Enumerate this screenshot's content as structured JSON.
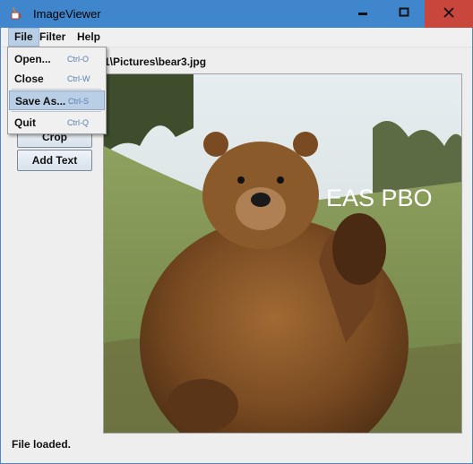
{
  "window": {
    "title": "ImageViewer",
    "controls": [
      "minimize-icon",
      "maximize-icon",
      "close-icon"
    ]
  },
  "menubar": {
    "items": [
      {
        "label": "File"
      },
      {
        "label": "Filter"
      },
      {
        "label": "Help"
      }
    ]
  },
  "file_menu": {
    "items": [
      {
        "label": "Open...",
        "shortcut": "Ctrl-O"
      },
      {
        "label": "Close",
        "shortcut": "Ctrl-W"
      },
      {
        "label": "Save As...",
        "shortcut": "Ctrl-S"
      },
      {
        "label": "Quit",
        "shortcut": "Ctrl-Q"
      }
    ]
  },
  "sidebar": {
    "buttons": [
      {
        "label": "Crop"
      },
      {
        "label": "Add Text"
      }
    ]
  },
  "main": {
    "path_label": "1\\Pictures\\bear3.jpg",
    "image_overlay_text": "EAS PBO"
  },
  "status": {
    "text": "File loaded."
  },
  "colors": {
    "titlebar": "#3f86cc",
    "close_button": "#c9463d",
    "menu_highlight": "#b8cfe5"
  }
}
